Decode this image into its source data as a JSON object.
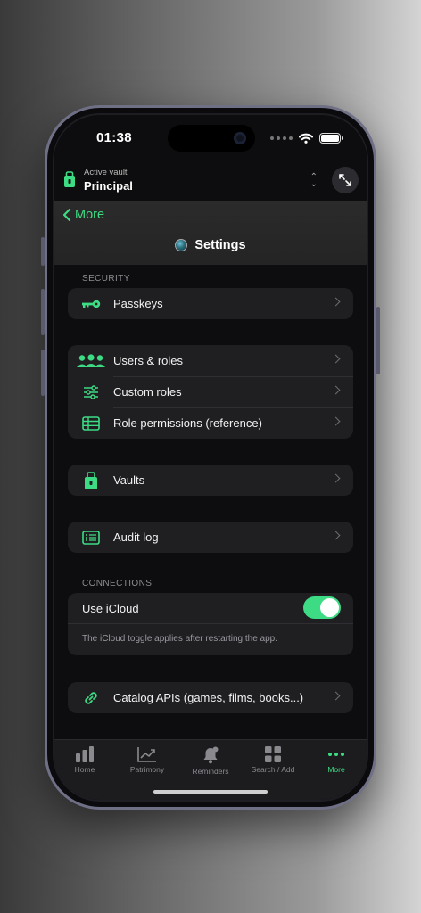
{
  "status": {
    "time": "01:38"
  },
  "vault": {
    "caption": "Active vault",
    "name": "Principal"
  },
  "nav": {
    "back_label": "More",
    "title": "Settings"
  },
  "sections": {
    "security": "SECURITY",
    "connections": "CONNECTIONS"
  },
  "rows": {
    "passkeys": "Passkeys",
    "users_roles": "Users & roles",
    "custom_roles": "Custom roles",
    "role_permissions": "Role permissions (reference)",
    "vaults": "Vaults",
    "audit_log": "Audit log",
    "use_icloud": "Use iCloud",
    "icloud_note": "The iCloud toggle applies after restarting the app.",
    "catalog_apis": "Catalog APIs (games, films, books...)"
  },
  "toggles": {
    "use_icloud": true
  },
  "tabs": [
    {
      "label": "Home",
      "icon": "bar-chart-icon"
    },
    {
      "label": "Patrimony",
      "icon": "trend-chart-icon"
    },
    {
      "label": "Reminders",
      "icon": "bell-icon"
    },
    {
      "label": "Search / Add",
      "icon": "grid-icon"
    },
    {
      "label": "More",
      "icon": "ellipsis-icon",
      "active": true
    }
  ],
  "colors": {
    "accent": "#3ddc84",
    "background": "#0d0d0f",
    "card": "#1f1f22"
  }
}
